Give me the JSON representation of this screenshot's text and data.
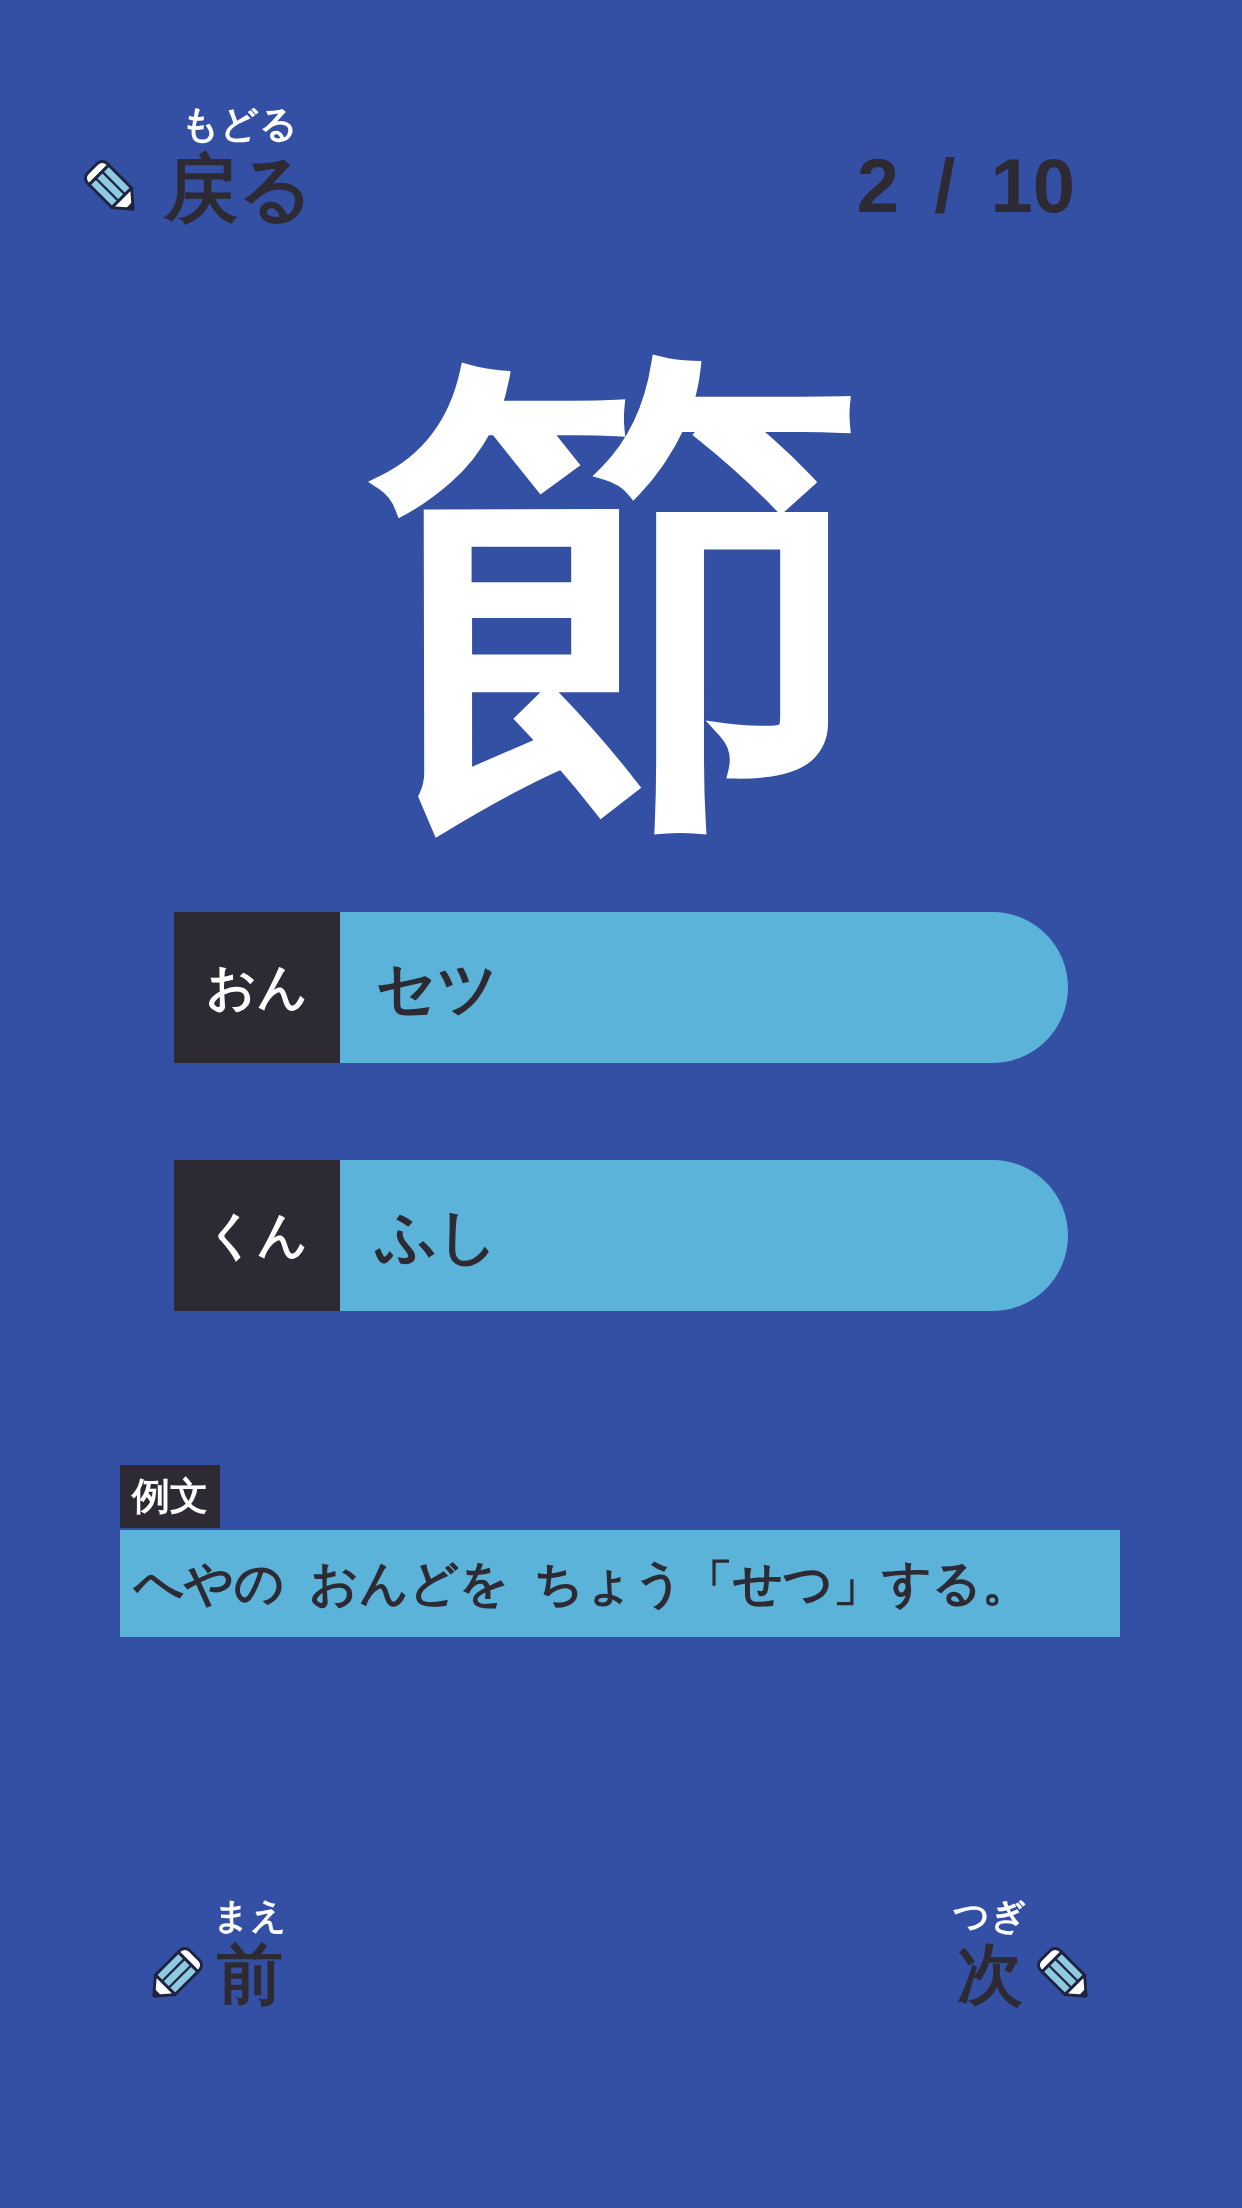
{
  "back_button": {
    "ruby": "もどる",
    "label": "戻る"
  },
  "counter": "2 / 10",
  "kanji": "節",
  "readings": [
    {
      "tag": "おん",
      "value": "セツ"
    },
    {
      "tag": "くん",
      "value": "ふし"
    }
  ],
  "example": {
    "tag": "例文",
    "sentence": "へやの おんどを ちょう「せつ」する。"
  },
  "nav": [
    {
      "kind": "prev",
      "ruby": "まえ",
      "label": "前"
    },
    {
      "kind": "next",
      "ruby": "つぎ",
      "label": "次"
    }
  ]
}
